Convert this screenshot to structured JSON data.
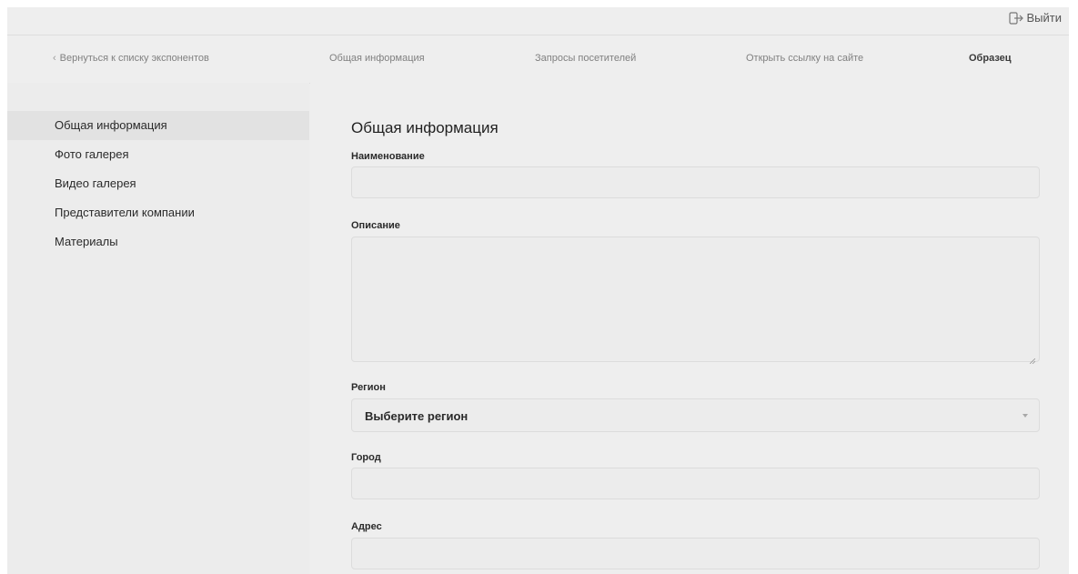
{
  "header": {
    "logout_label": "Выйти"
  },
  "nav": {
    "back_label": "Вернуться к списку экспонентов",
    "back_chevron": "‹",
    "general_label": "Общая информация",
    "requests_label": "Запросы посетителей",
    "open_link_label": "Открыть ссылку на сайте",
    "sample_label": "Образец"
  },
  "sidebar": {
    "items": [
      {
        "label": "Общая информация",
        "active": true
      },
      {
        "label": "Фото галерея",
        "active": false
      },
      {
        "label": "Видео галерея",
        "active": false
      },
      {
        "label": "Представители компании",
        "active": false
      },
      {
        "label": "Материалы",
        "active": false
      }
    ]
  },
  "form": {
    "title": "Общая информация",
    "name_label": "Наименование",
    "name_value": "",
    "description_label": "Описание",
    "description_value": "",
    "region_label": "Регион",
    "region_selected": "Выберите регион",
    "city_label": "Город",
    "city_value": "",
    "address_label": "Адрес",
    "address_value": ""
  },
  "icons": {
    "logout": "logout-icon",
    "back": "chevron-left-icon",
    "select_arrow": "chevron-down-icon",
    "resize": "resize-grip-icon"
  },
  "colors": {
    "background": "#eeeeee",
    "sidebar_active": "#e2e2e2",
    "input_border": "#dcdcdc"
  }
}
